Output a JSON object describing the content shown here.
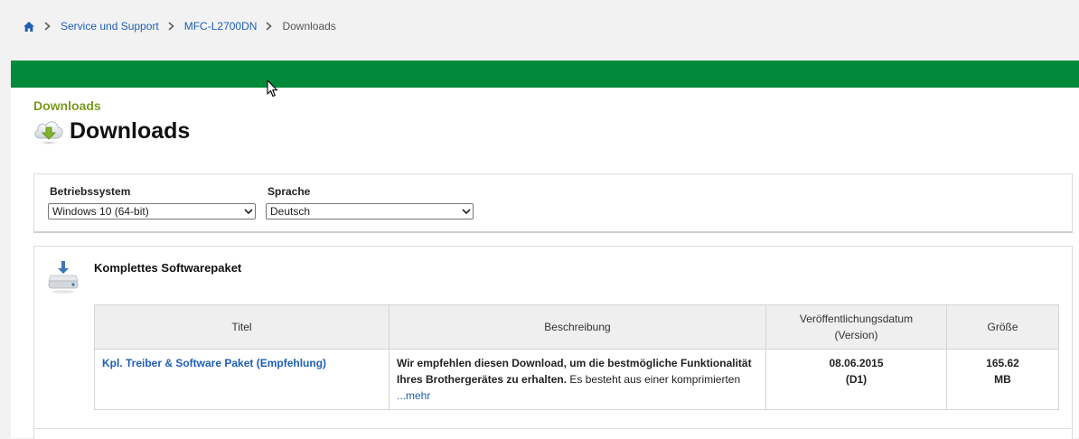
{
  "breadcrumb": {
    "home_icon": "home-icon",
    "items": [
      "Service und Support",
      "MFC-L2700DN"
    ],
    "current": "Downloads"
  },
  "header": {
    "bar_color": "#008a3a",
    "pre_title": "Downloads",
    "title": "Downloads",
    "title_icon": "cloud-download-icon"
  },
  "filters": {
    "os_label": "Betriebssystem",
    "os_value": "Windows 10 (64-bit)",
    "lang_label": "Sprache",
    "lang_value": "Deutsch"
  },
  "package": {
    "icon": "download-drive-icon",
    "title": "Komplettes Softwarepaket",
    "table": {
      "headers": {
        "title": "Titel",
        "description": "Beschreibung",
        "date_line1": "Veröffentlichungsdatum",
        "date_line2": "(Version)",
        "size": "Größe"
      },
      "rows": [
        {
          "title": "Kpl. Treiber & Software Paket (Empfehlung)",
          "desc_strong": "Wir empfehlen diesen Download, um die bestmögliche Funktionalität Ihres Brothergerätes zu erhalten.",
          "desc_rest": " Es besteht aus einer komprimierten",
          "more": "...mehr",
          "date": "08.06.2015",
          "version": "(D1)",
          "size_value": "165.62",
          "size_unit": "MB"
        }
      ]
    }
  }
}
